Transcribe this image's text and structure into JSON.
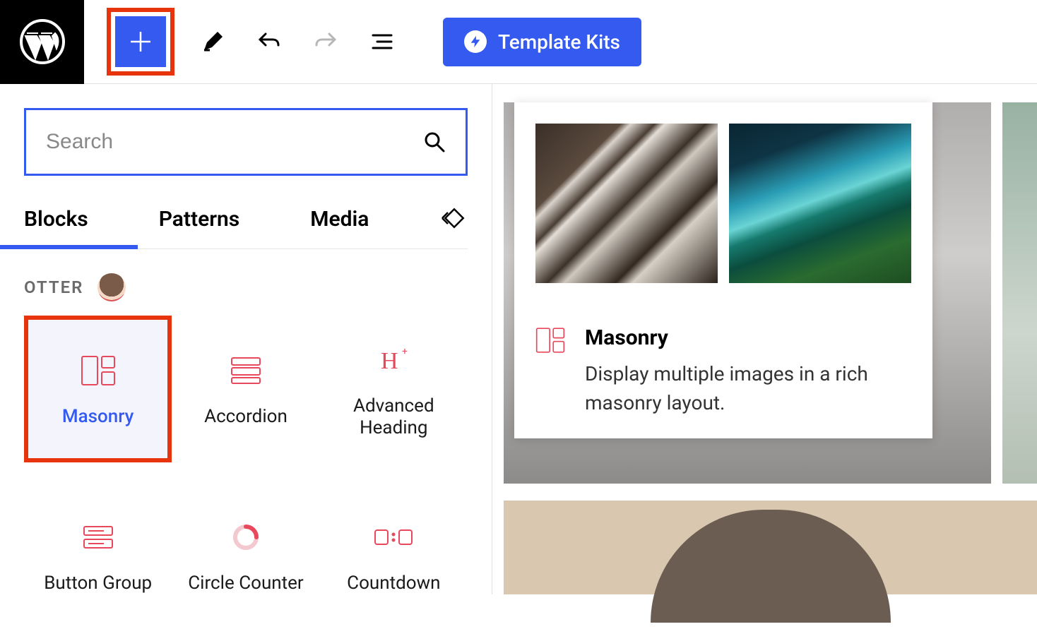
{
  "toolbar": {
    "template_kits_label": "Template Kits"
  },
  "panel": {
    "search_placeholder": "Search",
    "tabs": {
      "blocks": "Blocks",
      "patterns": "Patterns",
      "media": "Media"
    },
    "category": "OTTER",
    "blocks": [
      {
        "label": "Masonry"
      },
      {
        "label": "Accordion"
      },
      {
        "label": "Advanced\nHeading"
      },
      {
        "label": "Button Group"
      },
      {
        "label": "Circle Counter"
      },
      {
        "label": "Countdown"
      }
    ]
  },
  "popover": {
    "title": "Masonry",
    "description": "Display multiple images in a rich masonry layout."
  }
}
